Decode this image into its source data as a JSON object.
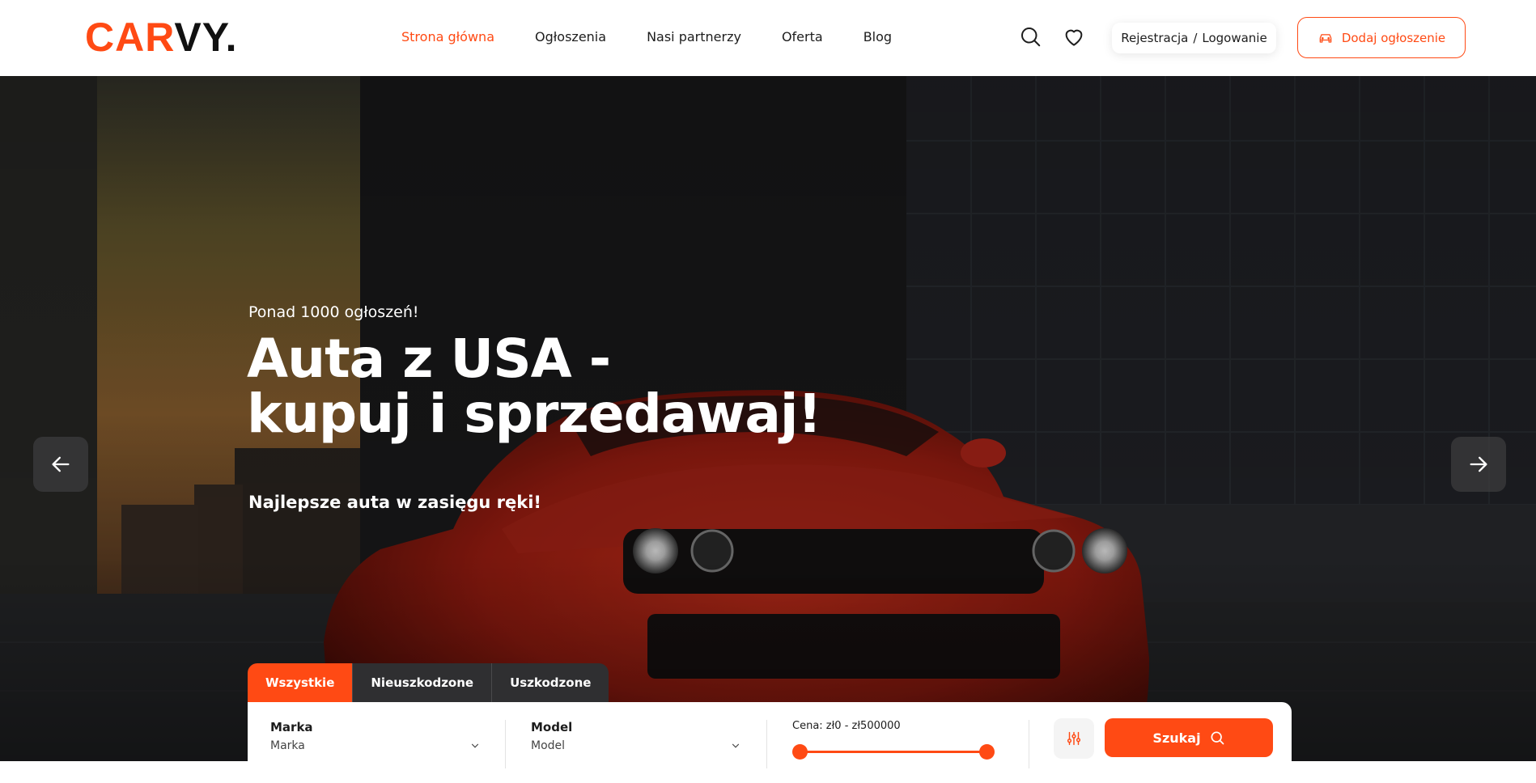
{
  "brand": {
    "part1": "CAR",
    "part2": "VY.",
    "accent_color": "#ff4a14"
  },
  "nav": {
    "items": [
      {
        "label": "Strona główna",
        "active": true
      },
      {
        "label": "Ogłoszenia"
      },
      {
        "label": "Nasi partnerzy"
      },
      {
        "label": "Oferta"
      },
      {
        "label": "Blog"
      }
    ]
  },
  "header": {
    "search_icon": "search-icon",
    "favorites_icon": "heart-icon",
    "register_label": "Rejestracja",
    "login_separator": "/",
    "login_label": "Logowanie",
    "add_listing_label": "Dodaj ogłoszenie",
    "add_listing_icon": "car-icon"
  },
  "hero": {
    "kicker": "Ponad 1000 ogłoszeń!",
    "headline_line1": "Auta z USA -",
    "headline_line2": "kupuj i sprzedawaj!",
    "subline": "Najlepsze auta w zasięgu ręki!",
    "prev_icon": "arrow-left-icon",
    "next_icon": "arrow-right-icon"
  },
  "search": {
    "tabs": [
      {
        "label": "Wszystkie",
        "active": true
      },
      {
        "label": "Nieuszkodzone"
      },
      {
        "label": "Uszkodzone"
      }
    ],
    "brand_label": "Marka",
    "brand_value": "Marka",
    "model_label": "Model",
    "model_value": "Model",
    "price_label": "Cena: zł0 - zł500000",
    "price_min": 0,
    "price_max": 500000,
    "price_range_min": 0,
    "price_range_max": 500000,
    "filter_icon": "sliders-icon",
    "submit_label": "Szukaj",
    "submit_icon": "search-icon"
  }
}
